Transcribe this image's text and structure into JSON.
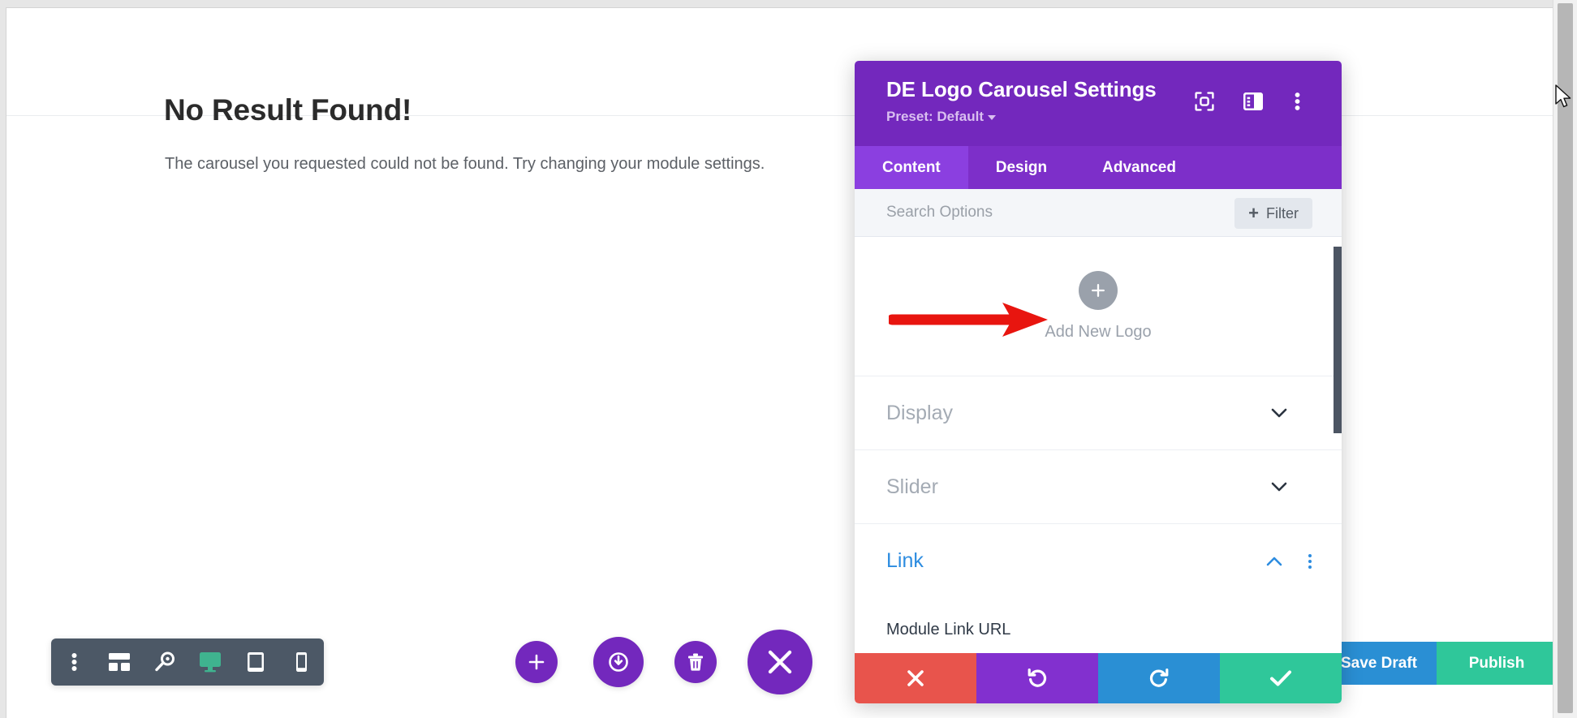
{
  "page": {
    "title": "No Result Found!",
    "subtitle": "The carousel you requested could not be found. Try changing your module settings."
  },
  "device_toolbar": {
    "items": [
      {
        "name": "more-options",
        "icon": "kebab-icon",
        "active": false
      },
      {
        "name": "wireframe-view",
        "icon": "wireframe-icon",
        "active": false
      },
      {
        "name": "zoom-view",
        "icon": "magnifier-icon",
        "active": false
      },
      {
        "name": "desktop-view",
        "icon": "desktop-icon",
        "active": true
      },
      {
        "name": "tablet-view",
        "icon": "tablet-icon",
        "active": false
      },
      {
        "name": "phone-view",
        "icon": "phone-icon",
        "active": false
      }
    ],
    "active_color": "#3fb38f",
    "background": "#4c5866"
  },
  "builder_actions": {
    "add_section": "plus-icon",
    "save_to_library": "power-icon",
    "delete": "trash-icon",
    "close_builder": "close-x-icon",
    "color": "#7328bd"
  },
  "footer_page_buttons": {
    "save_draft_label": "Save Draft",
    "save_draft_color": "#2a8fd4",
    "publish_label": "Publish",
    "publish_color": "#2fc79a"
  },
  "settings_modal": {
    "title": "DE Logo Carousel Settings",
    "preset_label": "Preset: Default",
    "header_color": "#7328bd",
    "header_icons": [
      {
        "name": "focus-icon",
        "label": "Focus Mode"
      },
      {
        "name": "layout-panel-icon",
        "label": "Change Layout"
      },
      {
        "name": "kebab-menu-icon",
        "label": "More Options"
      }
    ],
    "tabs": [
      {
        "label": "Content",
        "active": true
      },
      {
        "label": "Design",
        "active": false
      },
      {
        "label": "Advanced",
        "active": false
      }
    ],
    "search": {
      "placeholder": "Search Options",
      "value": ""
    },
    "filter": {
      "label": "Filter",
      "plus": "+"
    },
    "add_logo": {
      "label": "Add New Logo",
      "icon": "plus-icon"
    },
    "toggles": [
      {
        "label": "Display",
        "open": false,
        "has_kebab": false
      },
      {
        "label": "Slider",
        "open": false,
        "has_kebab": false
      },
      {
        "label": "Link",
        "open": true,
        "has_kebab": true
      }
    ],
    "link_section": {
      "field_label": "Module Link URL"
    },
    "footer_buttons": [
      {
        "name": "cancel-changes-button",
        "icon": "x-icon",
        "color": "#e8544c"
      },
      {
        "name": "undo-button",
        "icon": "undo-icon",
        "color": "#8230cf"
      },
      {
        "name": "redo-button",
        "icon": "redo-icon",
        "color": "#2a8fd4"
      },
      {
        "name": "save-changes-button",
        "icon": "check-icon",
        "color": "#2fc79a"
      }
    ]
  },
  "annotation": {
    "arrow_color": "#e8150f",
    "points_to": "add-new-logo-button"
  }
}
